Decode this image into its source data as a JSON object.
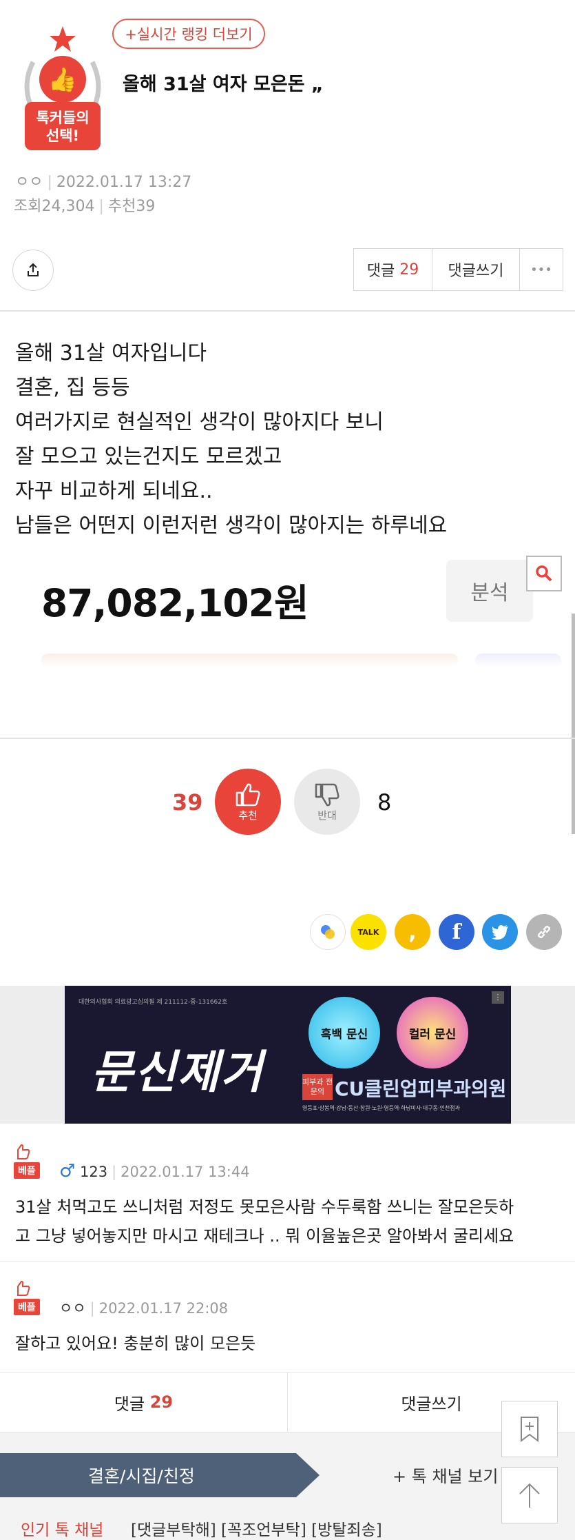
{
  "header": {
    "ranking_button": "+실시간 랭킹 더보기",
    "badge_text_line1": "톡커들의",
    "badge_text_line2": "선택!",
    "title": "올해 31살 여자 모은돈 „",
    "author": "ㅇㅇ",
    "date": "2022.01.17 13:27",
    "views_label": "조회",
    "views": "24,304",
    "recommend_label": "추천",
    "recommend": "39"
  },
  "actions": {
    "comment_label": "댓글",
    "comment_count": "29",
    "write_label": "댓글쓰기",
    "more_label": "•••"
  },
  "body": {
    "lines": [
      "올해 31살 여자입니다",
      "결혼, 집 등등",
      "여러가지로 현실적인 생각이 많아지다 보니",
      "잘 모으고 있는건지도 모르겠고",
      "자꾸 비교하게 되네요..",
      "남들은 어떤지 이런저런 생각이 많아지는 하루네요"
    ],
    "money": "87,082,102원",
    "analyze_label": "분석"
  },
  "votes": {
    "up_count": "39",
    "up_label": "추천",
    "down_count": "8",
    "down_label": "반대"
  },
  "ad": {
    "notice": "대한의사협회 의료광고심의필 제 211112-중-131662호",
    "headline": "문신제거",
    "circle1": "흑백 문신",
    "circle2": "컬러 문신",
    "tag": "피부과 전문의",
    "clinic": "CU클린업피부과의원",
    "address": "영등포·상봉역·강남·동산·창원·노원·영등역·하남미사·대구동·인천점과"
  },
  "comments": [
    {
      "badge": "베플",
      "gender": "♂",
      "author": "123",
      "date": "2022.01.17 13:44",
      "text1": "31살 처먹고도 쓰니처럼 저정도 못모은사람 수두룩함 쓰니는 잘모은듯하",
      "text2": "고 그냥 넣어놓지만 마시고 재테크나 .. 뭐 이율높은곳 알아봐서 굴리세요"
    },
    {
      "badge": "베플",
      "author": "ㅇㅇ",
      "date": "2022.01.17 22:08",
      "text1": "잘하고 있어요! 충분히 많이 모은듯"
    }
  ],
  "bottom": {
    "comment_label": "댓글",
    "comment_count": "29",
    "write_label": "댓글쓰기"
  },
  "channel": {
    "name": "결혼/시집/친정",
    "more": "+ 톡 채널 보기",
    "hot_label": "인기 톡 채널",
    "hot_links": "[댓글부탁해] [꼭조언부탁] [방탈죄송]"
  }
}
